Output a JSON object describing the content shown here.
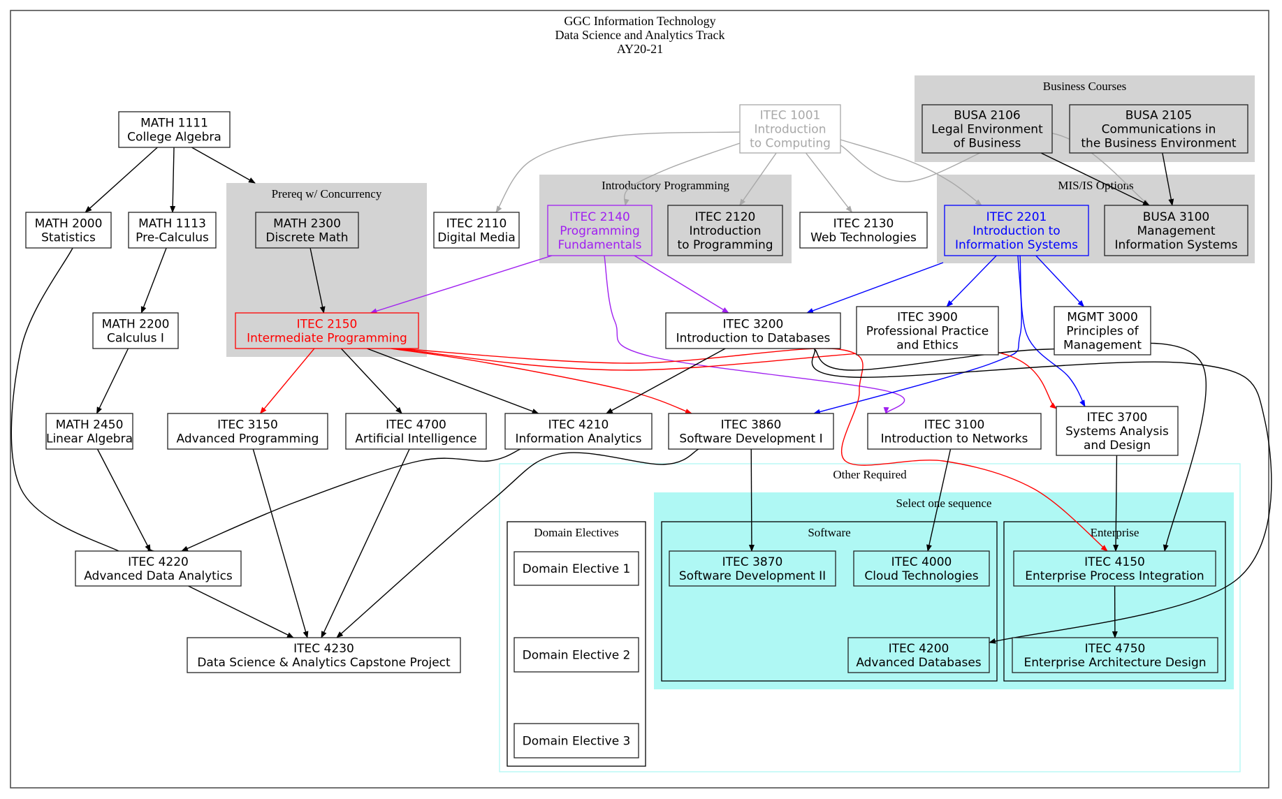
{
  "title": {
    "lines": [
      "GGC Information Technology",
      "Data Science and Analytics Track",
      "AY20-21"
    ]
  },
  "colors": {
    "default": "#000000",
    "muted_gray": "#a8a8a8",
    "purple": "#a020f0",
    "red": "#ff0000",
    "blue": "#0000ff",
    "cluster_gray": "#d3d3d3",
    "cluster_cyan": "#aff8f4",
    "cluster_cyan_border": "#aff8f4"
  },
  "clusters": [
    {
      "id": "prereq",
      "label": "Prereq w/ Concurrency",
      "style": "gray"
    },
    {
      "id": "intro_prog",
      "label": "Introductory Programming",
      "style": "gray"
    },
    {
      "id": "business",
      "label": "Business Courses",
      "style": "gray"
    },
    {
      "id": "misis",
      "label": "MIS/IS Options",
      "style": "gray"
    },
    {
      "id": "other_required",
      "label": "Other Required",
      "style": "cyan-outline"
    },
    {
      "id": "domain_electives",
      "label": "Domain Electives",
      "style": "black-outline"
    },
    {
      "id": "select_one",
      "label": "Select one sequence",
      "style": "cyan-fill"
    },
    {
      "id": "software",
      "label": "Software",
      "style": "black-outline"
    },
    {
      "id": "enterprise",
      "label": "Enterprise",
      "style": "black-outline"
    }
  ],
  "nodes": [
    {
      "id": "MATH1111",
      "lines": [
        "MATH 1111",
        "College Algebra"
      ],
      "color": "default"
    },
    {
      "id": "MATH2000",
      "lines": [
        "MATH 2000",
        "Statistics"
      ],
      "color": "default"
    },
    {
      "id": "MATH1113",
      "lines": [
        "MATH 1113",
        "Pre-Calculus"
      ],
      "color": "default"
    },
    {
      "id": "MATH2300",
      "lines": [
        "MATH 2300",
        "Discrete Math"
      ],
      "color": "default"
    },
    {
      "id": "ITEC2150",
      "lines": [
        "ITEC 2150",
        "Intermediate Programming"
      ],
      "color": "red"
    },
    {
      "id": "ITEC2110",
      "lines": [
        "ITEC 2110",
        "Digital Media"
      ],
      "color": "default"
    },
    {
      "id": "ITEC2140",
      "lines": [
        "ITEC 2140",
        "Programming",
        "Fundamentals"
      ],
      "color": "purple"
    },
    {
      "id": "ITEC2120",
      "lines": [
        "ITEC 2120",
        "Introduction",
        "to Programming"
      ],
      "color": "default"
    },
    {
      "id": "ITEC1001",
      "lines": [
        "ITEC 1001",
        "Introduction",
        "to Computing"
      ],
      "color": "muted_gray"
    },
    {
      "id": "ITEC2130",
      "lines": [
        "ITEC 2130",
        "Web Technologies"
      ],
      "color": "default"
    },
    {
      "id": "BUSA2106",
      "lines": [
        "BUSA 2106",
        "Legal Environment",
        "of Business"
      ],
      "color": "default"
    },
    {
      "id": "BUSA2105",
      "lines": [
        "BUSA 2105",
        "Communications in",
        "the Business Environment"
      ],
      "color": "default"
    },
    {
      "id": "ITEC2201",
      "lines": [
        "ITEC 2201",
        "Introduction to",
        "Information Systems"
      ],
      "color": "blue"
    },
    {
      "id": "BUSA3100",
      "lines": [
        "BUSA 3100",
        "Management",
        "Information Systems"
      ],
      "color": "default"
    },
    {
      "id": "MATH2200",
      "lines": [
        "MATH 2200",
        "Calculus I"
      ],
      "color": "default"
    },
    {
      "id": "ITEC3200",
      "lines": [
        "ITEC 3200",
        "Introduction to Databases"
      ],
      "color": "default"
    },
    {
      "id": "ITEC3900",
      "lines": [
        "ITEC 3900",
        "Professional Practice",
        "and Ethics"
      ],
      "color": "default"
    },
    {
      "id": "MGMT3000",
      "lines": [
        "MGMT 3000",
        "Principles of",
        "Management"
      ],
      "color": "default"
    },
    {
      "id": "MATH2450",
      "lines": [
        "MATH 2450",
        "Linear Algebra"
      ],
      "color": "default"
    },
    {
      "id": "ITEC3150",
      "lines": [
        "ITEC 3150",
        "Advanced Programming"
      ],
      "color": "default"
    },
    {
      "id": "ITEC4700",
      "lines": [
        "ITEC 4700",
        "Artificial Intelligence"
      ],
      "color": "default"
    },
    {
      "id": "ITEC4210",
      "lines": [
        "ITEC 4210",
        "Information Analytics"
      ],
      "color": "default"
    },
    {
      "id": "ITEC3860",
      "lines": [
        "ITEC 3860",
        "Software Development I"
      ],
      "color": "default"
    },
    {
      "id": "ITEC3100",
      "lines": [
        "ITEC 3100",
        "Introduction to Networks"
      ],
      "color": "default"
    },
    {
      "id": "ITEC3700",
      "lines": [
        "ITEC 3700",
        "Systems Analysis",
        "and Design"
      ],
      "color": "default"
    },
    {
      "id": "DE1",
      "lines": [
        "Domain Elective 1"
      ],
      "color": "default"
    },
    {
      "id": "DE2",
      "lines": [
        "Domain Elective 2"
      ],
      "color": "default"
    },
    {
      "id": "DE3",
      "lines": [
        "Domain Elective 3"
      ],
      "color": "default"
    },
    {
      "id": "ITEC3870",
      "lines": [
        "ITEC 3870",
        "Software Development II"
      ],
      "color": "default"
    },
    {
      "id": "ITEC4000",
      "lines": [
        "ITEC 4000",
        "Cloud Technologies"
      ],
      "color": "default"
    },
    {
      "id": "ITEC4200",
      "lines": [
        "ITEC 4200",
        "Advanced Databases"
      ],
      "color": "default"
    },
    {
      "id": "ITEC4150",
      "lines": [
        "ITEC 4150",
        "Enterprise Process Integration"
      ],
      "color": "default"
    },
    {
      "id": "ITEC4750",
      "lines": [
        "ITEC 4750",
        "Enterprise Architecture Design"
      ],
      "color": "default"
    },
    {
      "id": "ITEC4220",
      "lines": [
        "ITEC 4220",
        "Advanced Data Analytics"
      ],
      "color": "default"
    },
    {
      "id": "ITEC4230",
      "lines": [
        "ITEC 4230",
        "Data Science & Analytics Capstone Project"
      ],
      "color": "default"
    }
  ],
  "edges": [
    {
      "from": "MATH1111",
      "to": "MATH2000",
      "color": "default"
    },
    {
      "from": "MATH1111",
      "to": "MATH1113",
      "color": "default"
    },
    {
      "from": "MATH1111",
      "to": "cluster:prereq",
      "color": "default"
    },
    {
      "from": "MATH1113",
      "to": "MATH2200",
      "color": "default"
    },
    {
      "from": "MATH2200",
      "to": "MATH2450",
      "color": "default"
    },
    {
      "from": "MATH2000",
      "to": "ITEC4220",
      "color": "default"
    },
    {
      "from": "MATH2450",
      "to": "ITEC4220",
      "color": "default"
    },
    {
      "from": "MATH2300",
      "to": "ITEC2150",
      "color": "default"
    },
    {
      "from": "ITEC1001",
      "to": "ITEC2110",
      "color": "muted_gray"
    },
    {
      "from": "ITEC1001",
      "to": "ITEC2140",
      "color": "muted_gray"
    },
    {
      "from": "ITEC1001",
      "to": "ITEC2120",
      "color": "muted_gray"
    },
    {
      "from": "ITEC1001",
      "to": "ITEC2130",
      "color": "muted_gray"
    },
    {
      "from": "ITEC1001",
      "to": "ITEC2201",
      "color": "muted_gray"
    },
    {
      "from": "ITEC1001",
      "to": "BUSA3100",
      "color": "muted_gray"
    },
    {
      "from": "BUSA2106",
      "to": "BUSA3100",
      "color": "default"
    },
    {
      "from": "BUSA2105",
      "to": "BUSA3100",
      "color": "default"
    },
    {
      "from": "ITEC2140",
      "to": "ITEC2150",
      "color": "purple"
    },
    {
      "from": "ITEC2140",
      "to": "ITEC3200",
      "color": "purple"
    },
    {
      "from": "ITEC2140",
      "to": "ITEC3100",
      "color": "purple"
    },
    {
      "from": "ITEC2201",
      "to": "ITEC3200",
      "color": "blue"
    },
    {
      "from": "ITEC2201",
      "to": "ITEC3900",
      "color": "blue"
    },
    {
      "from": "ITEC2201",
      "to": "MGMT3000",
      "color": "blue"
    },
    {
      "from": "ITEC2201",
      "to": "ITEC3860",
      "color": "blue"
    },
    {
      "from": "ITEC2201",
      "to": "ITEC3700",
      "color": "blue"
    },
    {
      "from": "ITEC2150",
      "to": "ITEC3150",
      "color": "red"
    },
    {
      "from": "ITEC2150",
      "to": "ITEC4700",
      "color": "default"
    },
    {
      "from": "ITEC2150",
      "to": "ITEC4210",
      "color": "default"
    },
    {
      "from": "ITEC2150",
      "to": "ITEC3860",
      "color": "red"
    },
    {
      "from": "ITEC2150",
      "to": "ITEC3700",
      "color": "red"
    },
    {
      "from": "ITEC2150",
      "to": "ITEC4150",
      "color": "red"
    },
    {
      "from": "ITEC3200",
      "to": "ITEC4210",
      "color": "default"
    },
    {
      "from": "ITEC3200",
      "to": "ITEC4150",
      "color": "default"
    },
    {
      "from": "ITEC3200",
      "to": "ITEC4200",
      "color": "default"
    },
    {
      "from": "ITEC4210",
      "to": "ITEC4220",
      "color": "default"
    },
    {
      "from": "ITEC3150",
      "to": "ITEC4230",
      "color": "default"
    },
    {
      "from": "ITEC4700",
      "to": "ITEC4230",
      "color": "default"
    },
    {
      "from": "ITEC3860",
      "to": "ITEC4230",
      "color": "default"
    },
    {
      "from": "ITEC4220",
      "to": "ITEC4230",
      "color": "default"
    },
    {
      "from": "ITEC3860",
      "to": "ITEC3870",
      "color": "default"
    },
    {
      "from": "ITEC3100",
      "to": "ITEC4000",
      "color": "default"
    },
    {
      "from": "ITEC3700",
      "to": "ITEC4150",
      "color": "default"
    },
    {
      "from": "ITEC4150",
      "to": "ITEC4750",
      "color": "default"
    }
  ]
}
